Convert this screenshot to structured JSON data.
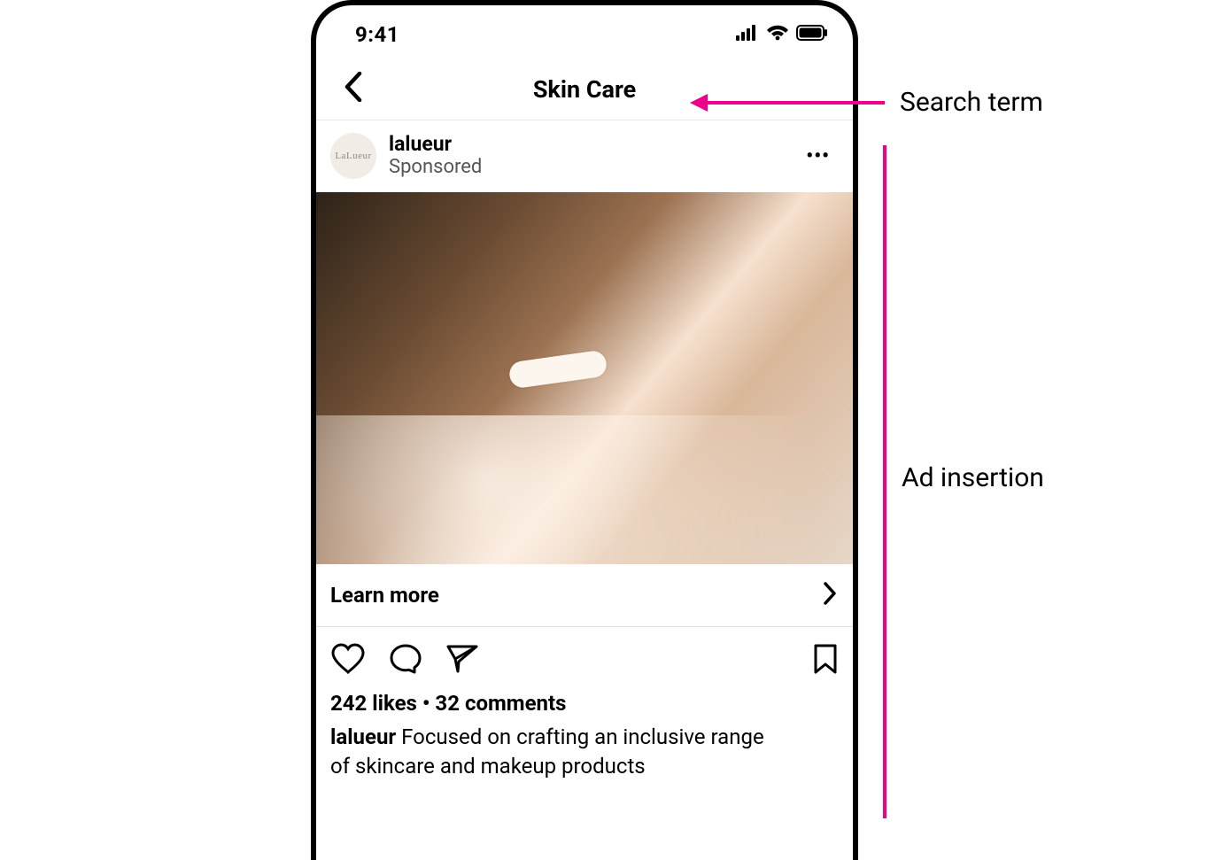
{
  "colors": {
    "accent": "#ec008c"
  },
  "status_bar": {
    "time": "9:41"
  },
  "nav": {
    "title": "Skin Care"
  },
  "post": {
    "avatar_text": "LaLueur",
    "username": "lalueur",
    "sponsored_label": "Sponsored",
    "more_glyph": "•••",
    "cta_label": "Learn more",
    "likes_count": "242",
    "likes_word": "likes",
    "separator": " • ",
    "comments_count": "32",
    "comments_word": "comments",
    "caption_user": "lalueur",
    "caption_text": " Focused on crafting an inclusive range of skincare and makeup products"
  },
  "annotations": {
    "search_term": "Search term",
    "ad_insertion": "Ad insertion"
  }
}
